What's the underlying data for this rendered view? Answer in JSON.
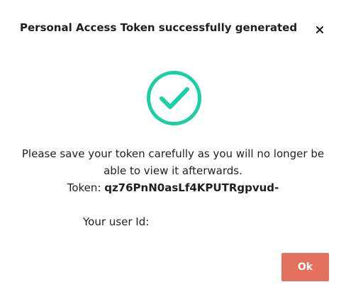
{
  "dialog": {
    "title": "Personal Access Token successfully generated",
    "close_icon": "close-icon",
    "success_icon": "check-circle-icon",
    "success_color": "#19d1a0",
    "message": "Please save your token carefully as you will no longer be able to view it afterwards.",
    "token_label": "Token:",
    "token_value": "qz76PnN0asLf4KPUTRgpvud-",
    "user_id_label": "Your user Id:",
    "user_id_value": "",
    "ok_label": "Ok",
    "ok_color": "#e4705e"
  }
}
